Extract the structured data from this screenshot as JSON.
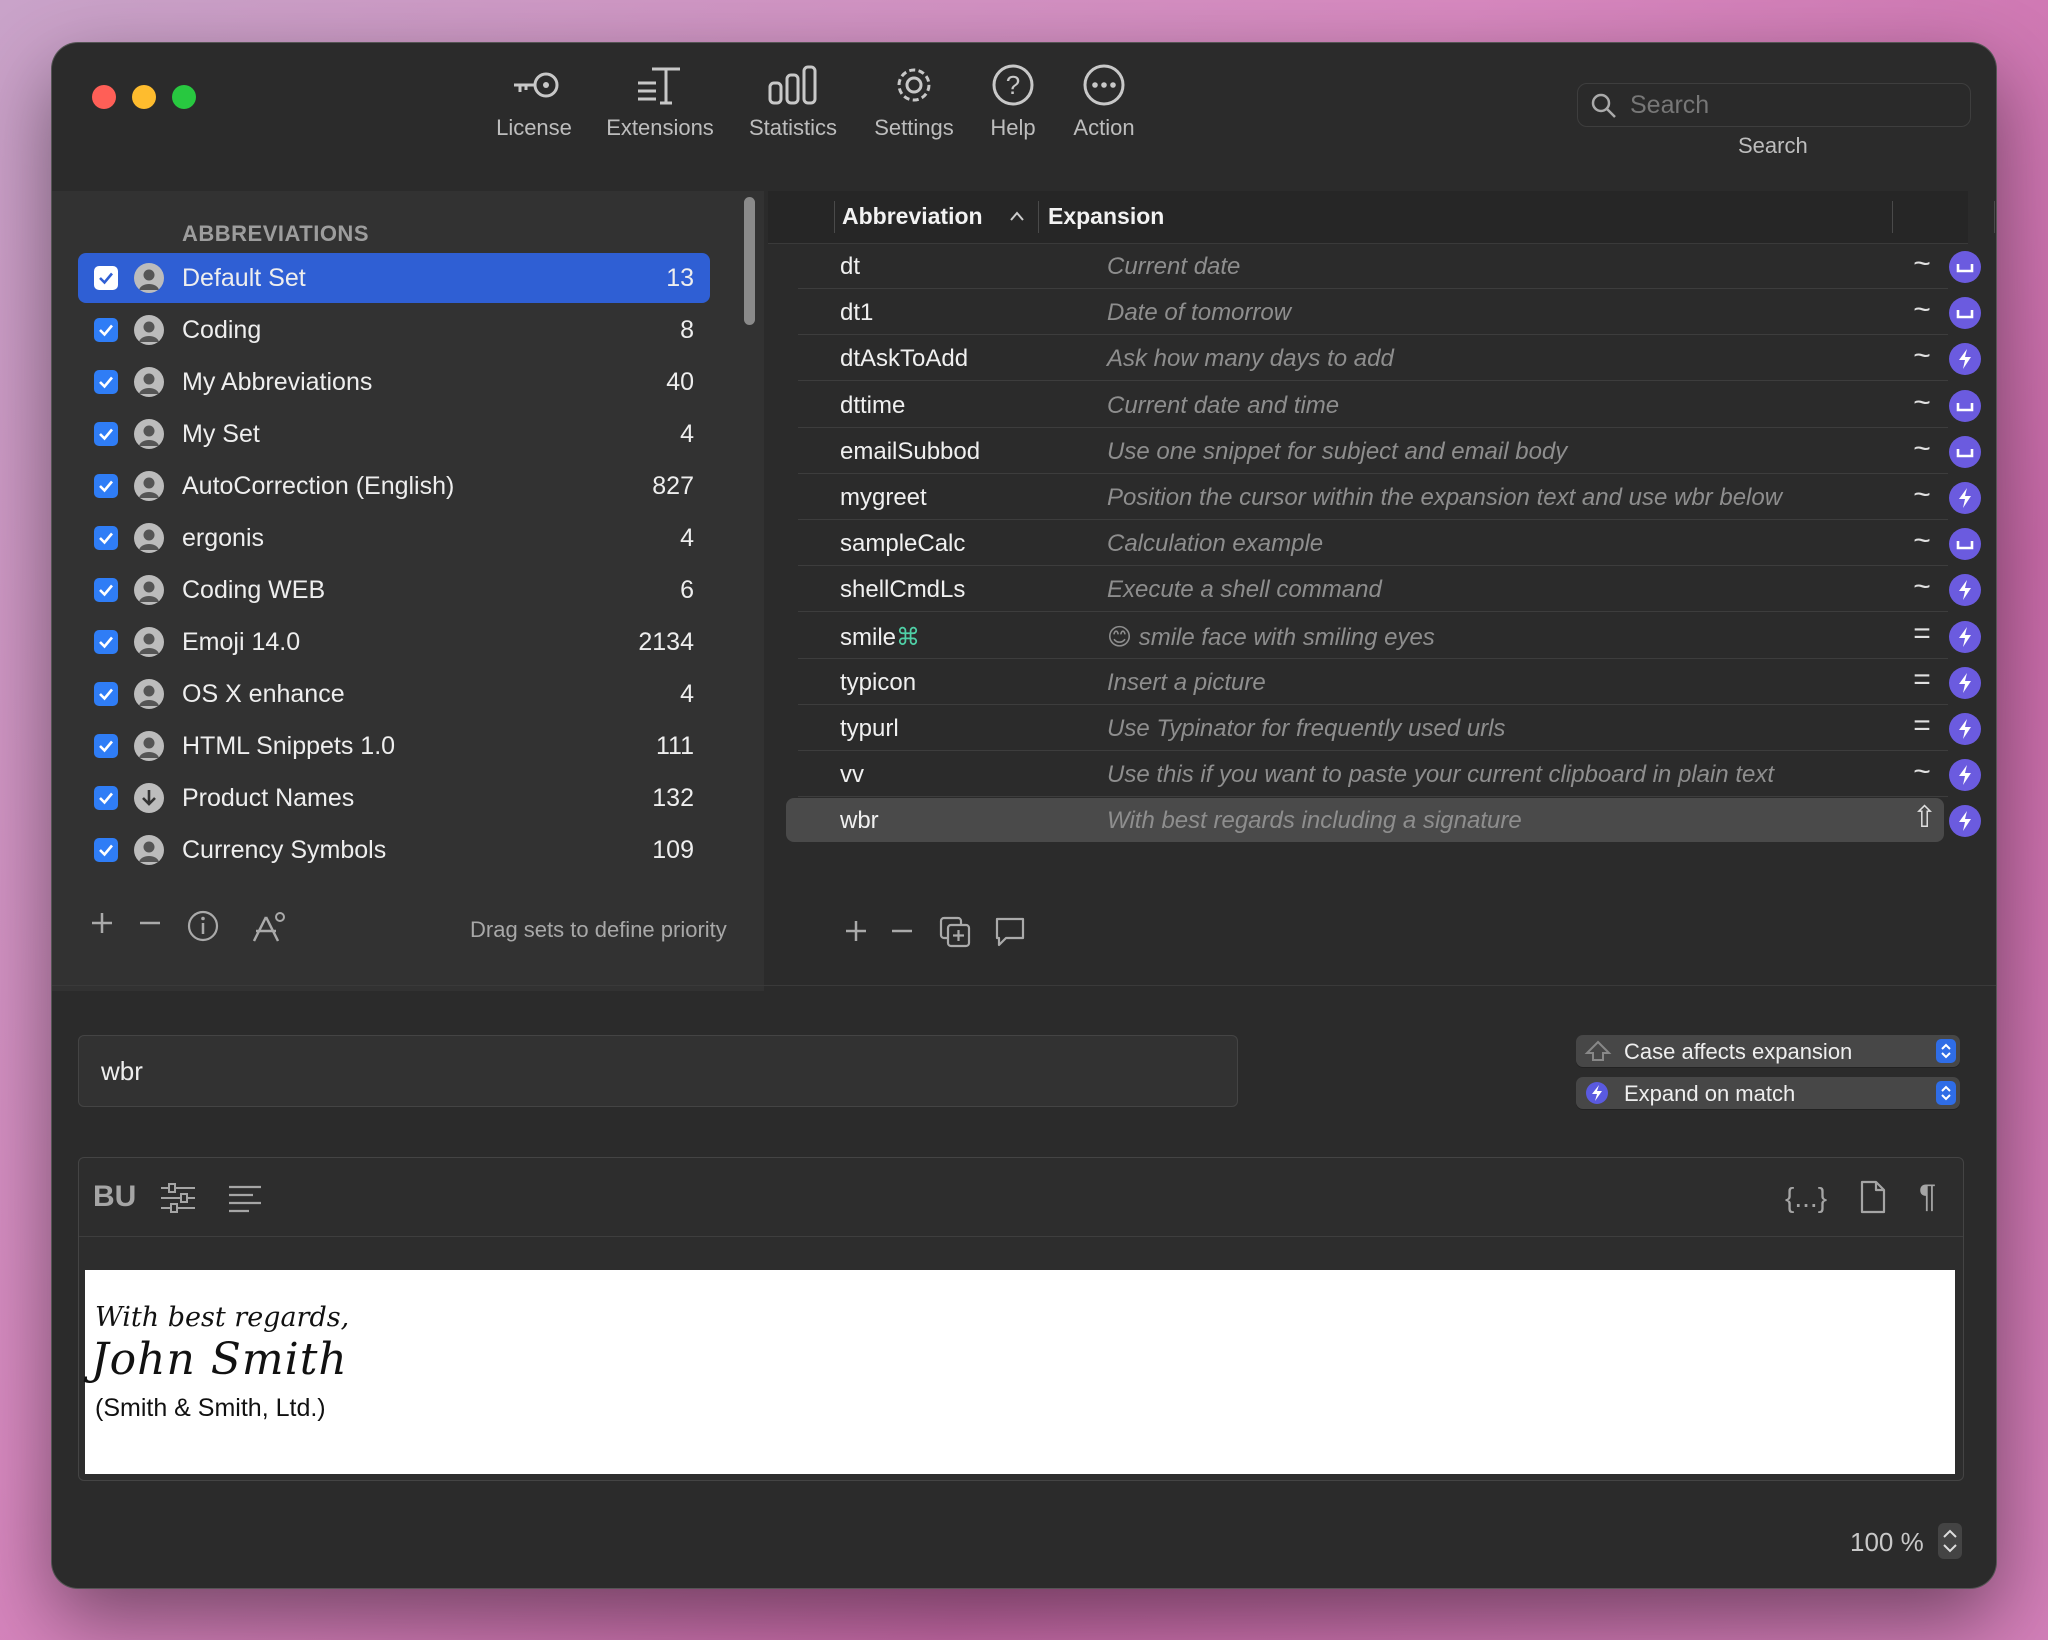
{
  "toolbar": {
    "items": [
      {
        "label": "License",
        "icon": "key-icon"
      },
      {
        "label": "Extensions",
        "icon": "extensions-icon"
      },
      {
        "label": "Statistics",
        "icon": "bar-chart-icon"
      },
      {
        "label": "Settings",
        "icon": "gear-icon"
      },
      {
        "label": "Help",
        "icon": "question-icon"
      },
      {
        "label": "Action",
        "icon": "ellipsis-icon"
      }
    ],
    "search": {
      "placeholder": "Search",
      "label": "Search"
    }
  },
  "sets": {
    "header": "ABBREVIATIONS",
    "items": [
      {
        "name": "Default Set",
        "count": "13",
        "selected": true,
        "checked": true
      },
      {
        "name": "Coding",
        "count": "8",
        "checked": true
      },
      {
        "name": "My Abbreviations",
        "count": "40",
        "checked": true
      },
      {
        "name": "My Set",
        "count": "4",
        "checked": true
      },
      {
        "name": "AutoCorrection (English)",
        "count": "827",
        "checked": true
      },
      {
        "name": "ergonis",
        "count": "4",
        "checked": true
      },
      {
        "name": "Coding WEB",
        "count": "6",
        "checked": true
      },
      {
        "name": "Emoji 14.0",
        "count": "2134",
        "checked": true
      },
      {
        "name": "OS X enhance",
        "count": "4",
        "checked": true
      },
      {
        "name": "HTML Snippets 1.0",
        "count": "111",
        "checked": true
      },
      {
        "name": "Product Names",
        "count": "132",
        "checked": true,
        "icon": "download-icon"
      },
      {
        "name": "Currency Symbols",
        "count": "109",
        "checked": true
      }
    ],
    "footer_hint": "Drag sets to define priority"
  },
  "table": {
    "columns": [
      "Abbreviation",
      "Expansion"
    ],
    "rows": [
      {
        "abbr": "dt",
        "expansion": "Current date",
        "mode": "~",
        "trigger": "space"
      },
      {
        "abbr": "dt1",
        "expansion": "Date of tomorrow",
        "mode": "~",
        "trigger": "space"
      },
      {
        "abbr": "dtAskToAdd",
        "expansion": "Ask how many days to add",
        "mode": "~",
        "trigger": "bolt"
      },
      {
        "abbr": "dttime",
        "expansion": "Current date and time",
        "mode": "~",
        "trigger": "space"
      },
      {
        "abbr": "emailSubbod",
        "expansion": "Use one snippet for subject and email body",
        "mode": "~",
        "trigger": "space"
      },
      {
        "abbr": "mygreet",
        "expansion": "Position the cursor within the expansion text and use wbr below",
        "mode": "~",
        "trigger": "bolt"
      },
      {
        "abbr": "sampleCalc",
        "expansion": "Calculation example",
        "mode": "~",
        "trigger": "space"
      },
      {
        "abbr": "shellCmdLs",
        "expansion": "Execute a shell command",
        "mode": "~",
        "trigger": "bolt"
      },
      {
        "abbr": "smile",
        "abbr_suffix": "⌘",
        "emoji": "😊",
        "expansion": "smile face with smiling eyes",
        "mode": "=",
        "trigger": "bolt"
      },
      {
        "abbr": "typicon",
        "expansion": "Insert a picture",
        "mode": "=",
        "trigger": "bolt"
      },
      {
        "abbr": "typurl",
        "expansion": "Use Typinator for frequently used urls",
        "mode": "=",
        "trigger": "bolt"
      },
      {
        "abbr": "vv",
        "expansion": "Use this if you want to paste your current clipboard in plain text",
        "mode": "~",
        "trigger": "bolt"
      },
      {
        "abbr": "wbr",
        "expansion": "With best regards including a signature",
        "mode": "⇧",
        "trigger": "bolt",
        "selected": true
      }
    ]
  },
  "editor": {
    "abbreviation_value": "wbr",
    "case_option": "Case affects expansion",
    "expand_option": "Expand on match",
    "format_button": "BU",
    "signature": {
      "line1": "With best regards,",
      "line2": "John Smith",
      "line3": "(Smith & Smith, Ltd.)"
    },
    "zoom": "100 %"
  },
  "colors": {
    "accent": "#2f5fd4",
    "checkbox": "#2f7df6",
    "badge": "#6b5bdf"
  }
}
